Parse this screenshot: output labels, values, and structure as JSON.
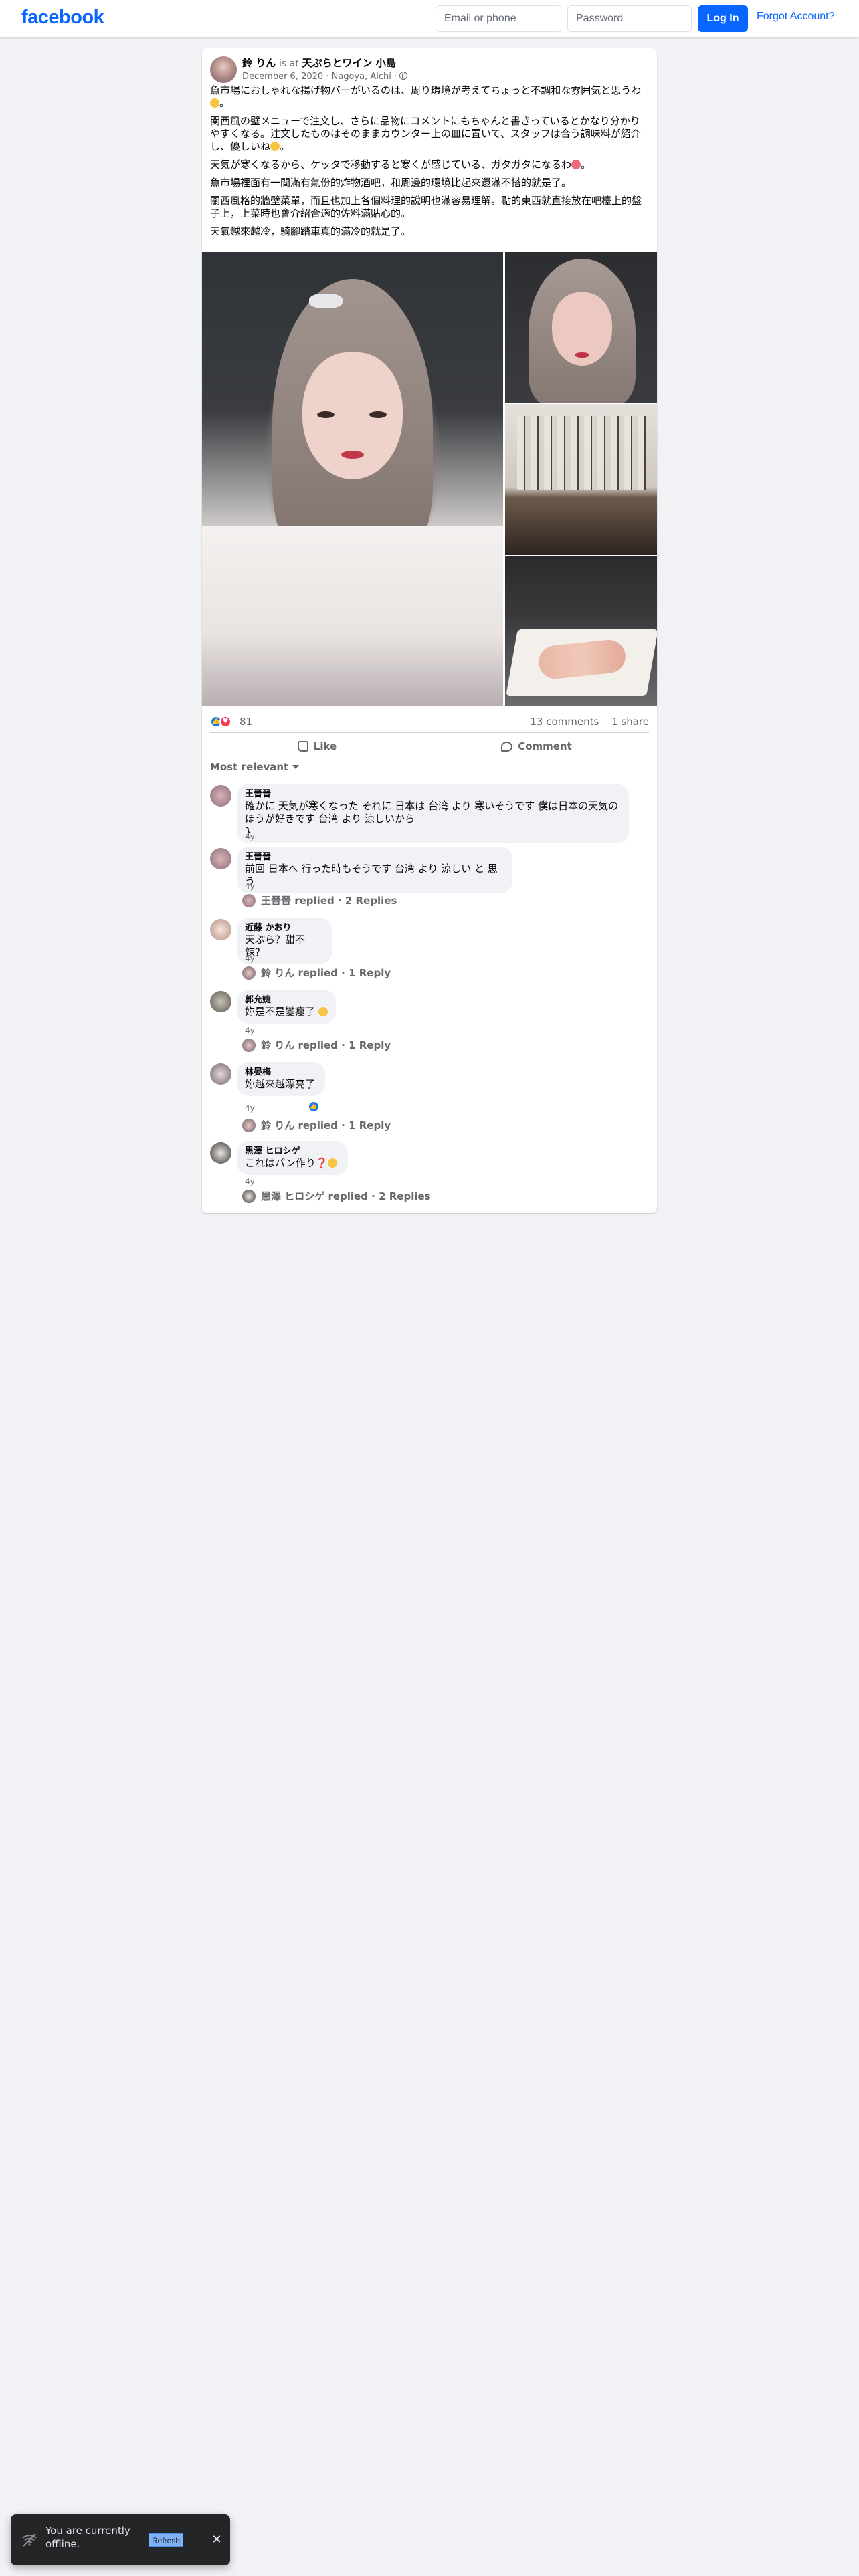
{
  "header": {
    "logo": "facebook",
    "email_placeholder": "Email or phone",
    "password_placeholder": "Password",
    "login_label": "Log In",
    "forgot_label": "Forgot Account?"
  },
  "post": {
    "author": "鈴 りん",
    "is_at": "is at",
    "place": "天ぷらとワイン 小島",
    "date": "December 6, 2020",
    "location": "Nagoya, Aichi",
    "paragraphs": [
      "魚市場におしゃれな揚げ物バーがいるのは、周り環境が考えてちょっと不調和な雰囲気と思うわ",
      "関西風の壁メニューで注文し、さらに品物にコメントにもちゃんと書きっているとかなり分かりやすくなる。注文したものはそのままカウンター上の皿に置いて、スタッフは合う調味料が紹介し、優しいね",
      "天気が寒くなるから、ケッタで移動すると寒くが感じている、ガタガタになるわ",
      "魚市場裡面有一間滿有氣份的炸物酒吧，和周邊的環境比起來還滿不搭的就是了。",
      "關西風格的牆壁菜單，而且也加上各個料理的說明也滿容易理解。點的東西就直接放在吧檯上的盤子上，上菜時也會介紹合適的佐料滿貼心的。",
      "天氣越來越冷，騎腳踏車真的滿冷的就是了。"
    ],
    "reaction_count": "81",
    "comments_count": "13 comments",
    "shares_count": "1 share",
    "like_label": "Like",
    "comment_label": "Comment",
    "sort_label": "Most relevant"
  },
  "comments": [
    {
      "name": "王晉晉",
      "text": "確かに 天気が寒くなった それに 日本は 台湾 より 寒いそうです 僕は日本の天気のほうが好きです 台湾 より 涼しいから",
      "time": "4y"
    },
    {
      "name": "王晉晉",
      "text": "前回 日本へ 行った時もそうです 台湾 より 涼しい と 思う",
      "time": "4y",
      "reply": "王晉晉 replied · 2 Replies"
    },
    {
      "name": "近藤 かおり",
      "text": "天ぷら？甜不辣？",
      "time": "4y",
      "reply": "鈴 りん replied · 1 Reply"
    },
    {
      "name": "郭允婕",
      "text": "妳是不是變瘦了",
      "time": "4y",
      "reply": "鈴 りん replied · 1 Reply"
    },
    {
      "name": "林晏梅",
      "text": "妳越來越漂亮了",
      "time": "4y",
      "reply": "鈴 りん replied · 1 Reply"
    },
    {
      "name": "黒澤 ヒロシゲ",
      "text": "これはパン作り❓",
      "time": "4y",
      "reply": "黒澤 ヒロシゲ replied · 2 Replies"
    }
  ],
  "toast": {
    "message": "You are currently offline.",
    "refresh_label": "Refresh"
  },
  "colors": {
    "brand": "#0866ff",
    "like": "#1877f2",
    "love": "#f33e58"
  }
}
